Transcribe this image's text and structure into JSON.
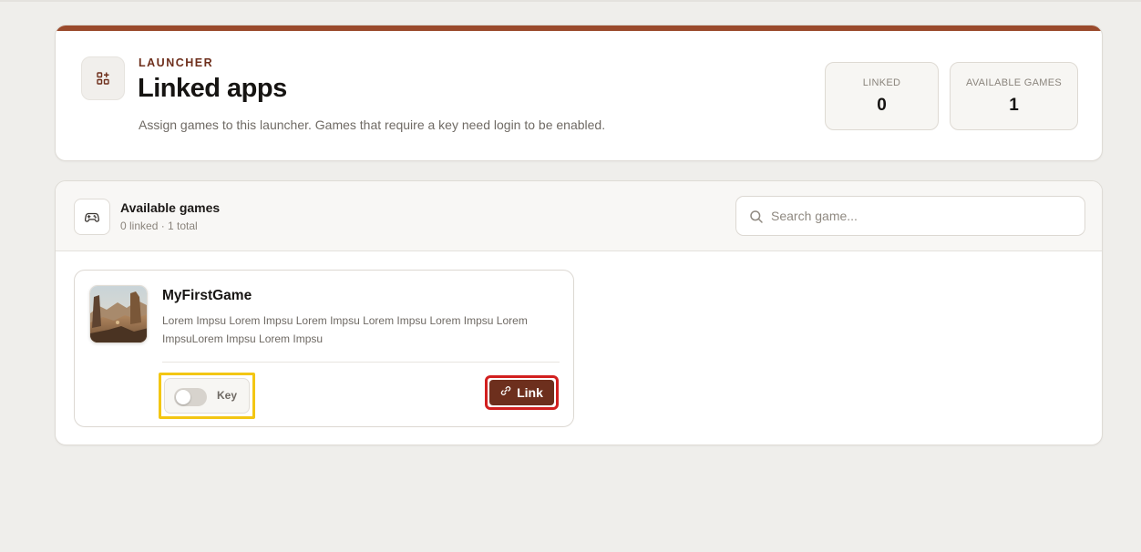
{
  "header": {
    "eyebrow": "LAUNCHER",
    "title": "Linked apps",
    "subtitle": "Assign games to this launcher. Games that require a key need login to be enabled.",
    "icon": "apps-add-icon",
    "accent_color": "#9a4a2c"
  },
  "stats": {
    "linked": {
      "label": "LINKED",
      "value": "0"
    },
    "available": {
      "label": "AVAILABLE GAMES",
      "value": "1"
    }
  },
  "games_panel": {
    "title": "Available games",
    "meta": "0 linked · 1 total",
    "icon": "gamepad-icon",
    "search": {
      "placeholder": "Search game...",
      "value": ""
    }
  },
  "games": [
    {
      "name": "MyFirstGame",
      "description": "Lorem Impsu Lorem Impsu Lorem Impsu Lorem Impsu Lorem Impsu Lorem ImpsuLorem Impsu Lorem Impsu",
      "key_label": "Key",
      "key_required": false,
      "link_label": "Link",
      "link_button_color": "#6d2f1d"
    }
  ]
}
